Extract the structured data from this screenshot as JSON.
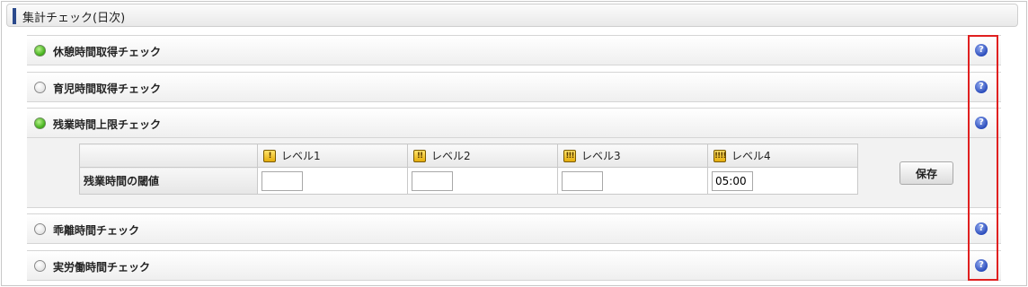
{
  "panel": {
    "title": "集計チェック(日次)"
  },
  "sections": [
    {
      "label": "休憩時間取得チェック",
      "checked": true
    },
    {
      "label": "育児時間取得チェック",
      "checked": false
    },
    {
      "label": "残業時間上限チェック",
      "checked": true
    },
    {
      "label": "乖離時間チェック",
      "checked": false
    },
    {
      "label": "実労働時間チェック",
      "checked": false
    }
  ],
  "help_icon": {
    "glyph": "?",
    "icon": "help-circle-icon",
    "color": "#2446b8"
  },
  "overtime_table": {
    "row_label": "残業時間の閾値",
    "levels": [
      {
        "label": "レベル1",
        "icon_glyph": "!",
        "value": ""
      },
      {
        "label": "レベル2",
        "icon_glyph": "!!",
        "value": ""
      },
      {
        "label": "レベル3",
        "icon_glyph": "!!!",
        "value": ""
      },
      {
        "label": "レベル4",
        "icon_glyph": "!!!!",
        "value": "05:00"
      }
    ]
  },
  "save_button": {
    "label": "保存"
  },
  "colors": {
    "accent": "#2b4a8c",
    "radio_on": "#3fae17",
    "highlight": "#e02020"
  }
}
